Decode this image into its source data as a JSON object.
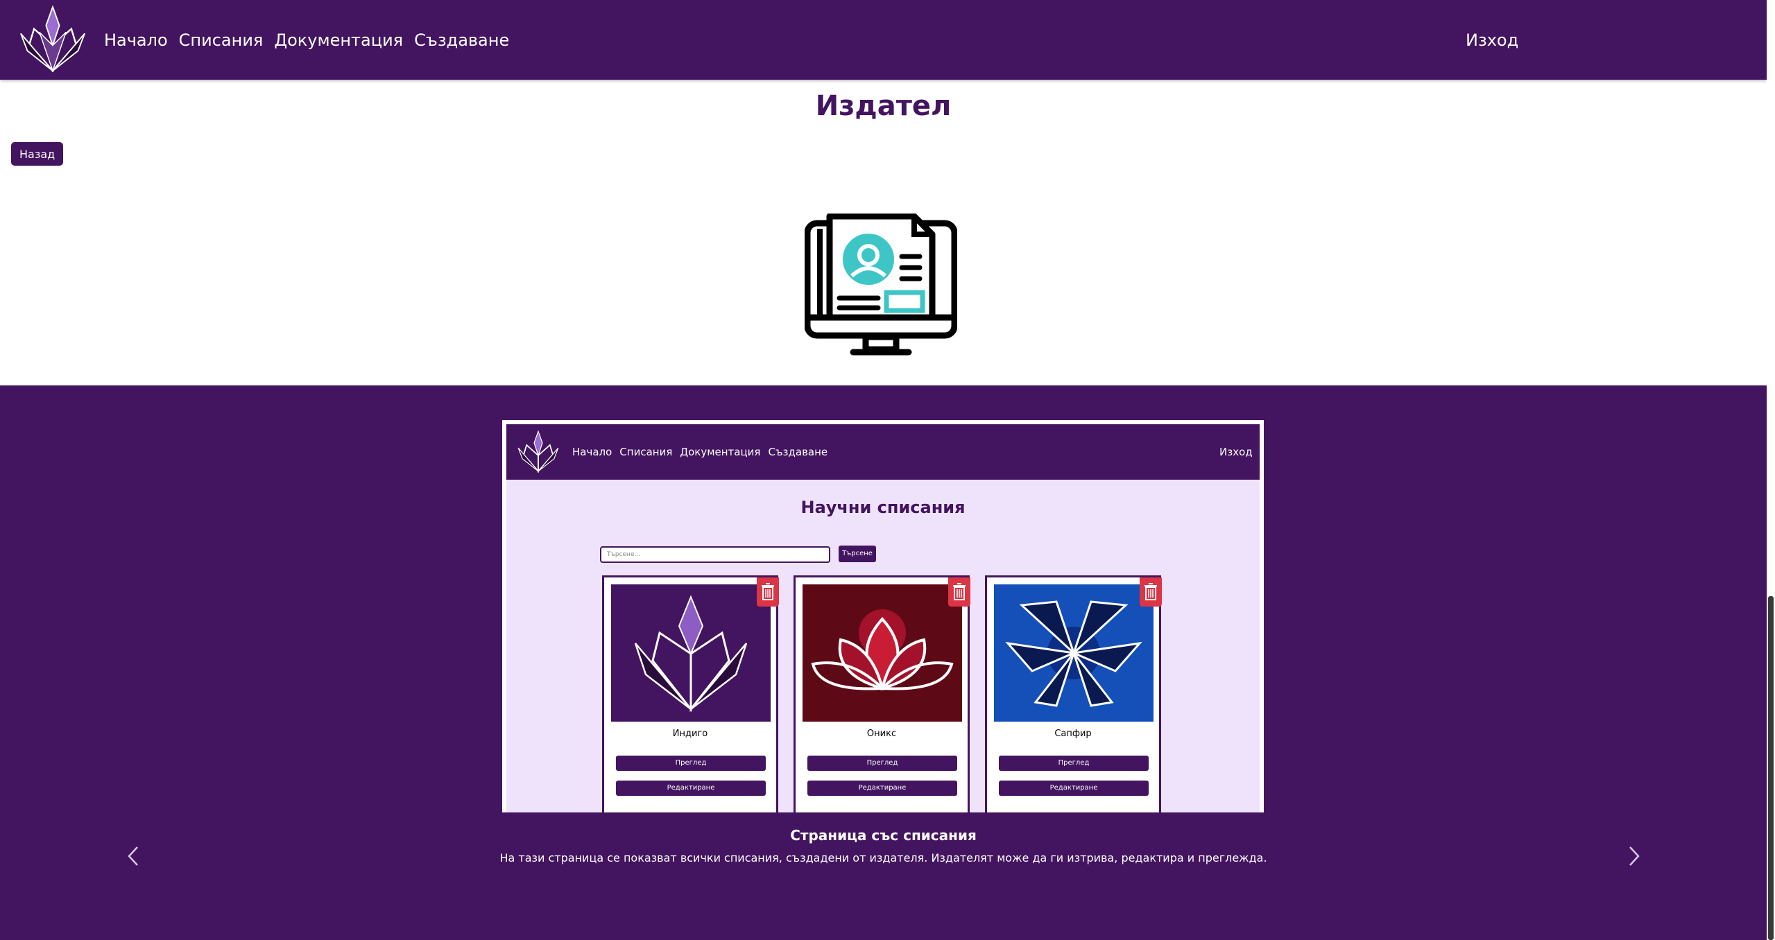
{
  "header": {
    "nav": [
      "Начало",
      "Списания",
      "Документация",
      "Създаване"
    ],
    "logout": "Изход"
  },
  "page": {
    "title": "Издател",
    "back_label": "Назад"
  },
  "carousel": {
    "slide": {
      "nav": [
        "Начало",
        "Списания",
        "Документация",
        "Създаване"
      ],
      "logout": "Изход",
      "title": "Научни списания",
      "search_placeholder": "Търсене...",
      "search_button": "Търсене",
      "cards": [
        {
          "name": "Индиго",
          "view": "Преглед",
          "edit": "Редактиране"
        },
        {
          "name": "Оникс",
          "view": "Преглед",
          "edit": "Редактиране"
        },
        {
          "name": "Сапфир",
          "view": "Преглед",
          "edit": "Редактиране"
        }
      ]
    },
    "caption_title": "Страница със списания",
    "caption_text": "На тази страница се показват всички списания, създадени от издателя. Издателят може да ги изтрива, редактира и преглежда."
  },
  "colors": {
    "brand": "#43145f",
    "light": "#eee3fb",
    "accent": "#3ec6c6",
    "danger": "#dc3545"
  },
  "icons": [
    "lotus-logo-icon",
    "publisher-computer-icon",
    "trash-icon",
    "chevron-left-icon",
    "chevron-right-icon"
  ]
}
